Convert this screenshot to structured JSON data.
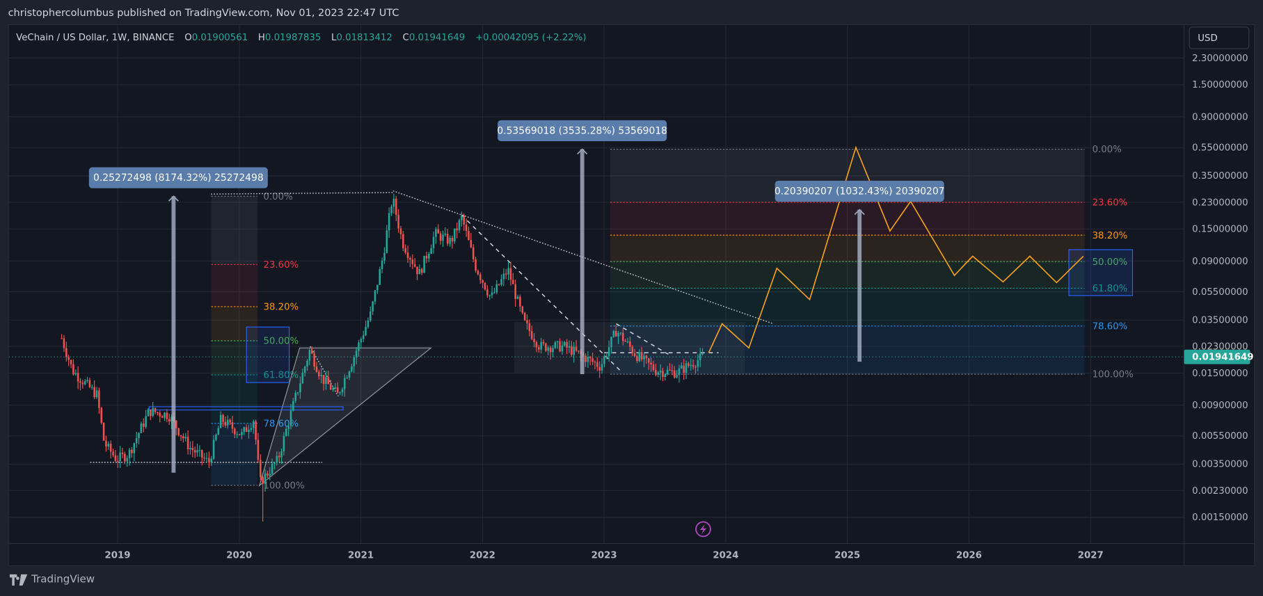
{
  "header": {
    "published": "christophercolumbus published on TradingView.com, Nov 01, 2023 22:47 UTC"
  },
  "legend": {
    "symbol": "VeChain / US Dollar, 1W, BINANCE",
    "o_label": "O",
    "o": "0.01900561",
    "h_label": "H",
    "h": "0.01987835",
    "l_label": "L",
    "l": "0.01813412",
    "c_label": "C",
    "c": "0.01941649",
    "change": "+0.00042095 (+2.22%)"
  },
  "price_axis": {
    "currency": "USD",
    "current_price": "0.01941649",
    "ticks": [
      {
        "value": 2.3,
        "label": "2.30000000"
      },
      {
        "value": 1.5,
        "label": "1.50000000"
      },
      {
        "value": 0.9,
        "label": "0.90000000"
      },
      {
        "value": 0.55,
        "label": "0.55000000"
      },
      {
        "value": 0.35,
        "label": "0.35000000"
      },
      {
        "value": 0.23,
        "label": "0.23000000"
      },
      {
        "value": 0.15,
        "label": "0.15000000"
      },
      {
        "value": 0.09,
        "label": "0.09000000"
      },
      {
        "value": 0.055,
        "label": "0.05500000"
      },
      {
        "value": 0.035,
        "label": "0.03500000"
      },
      {
        "value": 0.023,
        "label": "0.02300000"
      },
      {
        "value": 0.015,
        "label": "0.01500000"
      },
      {
        "value": 0.009,
        "label": "0.00900000"
      },
      {
        "value": 0.0055,
        "label": "0.00550000"
      },
      {
        "value": 0.0035,
        "label": "0.00350000"
      },
      {
        "value": 0.0023,
        "label": "0.00230000"
      },
      {
        "value": 0.0015,
        "label": "0.00150000"
      }
    ]
  },
  "time_axis": {
    "ticks": [
      "2019",
      "2020",
      "2021",
      "2022",
      "2023",
      "2024",
      "2025",
      "2026",
      "2027"
    ]
  },
  "footer": {
    "logo_text": "TradingView"
  },
  "colors": {
    "up": "#26a69a",
    "down": "#ef5350",
    "projection": "#f7a21b",
    "measure": "#5a7cab",
    "background": "#131722",
    "alert": "#ab47bc"
  },
  "chart_data": {
    "type": "candlestick",
    "title": "VeChain / US Dollar, 1W, BINANCE",
    "scale": "log",
    "ylim": [
      0.0013,
      2.6
    ],
    "xlim": [
      2018.45,
      2027.8
    ],
    "price_path": [
      [
        2018.54,
        0.0262
      ],
      [
        2018.63,
        0.0156
      ],
      [
        2018.83,
        0.0106
      ],
      [
        2018.89,
        0.0049
      ],
      [
        2018.99,
        0.0038
      ],
      [
        2019.09,
        0.0041
      ],
      [
        2019.26,
        0.0082
      ],
      [
        2019.42,
        0.0077
      ],
      [
        2019.59,
        0.0046
      ],
      [
        2019.75,
        0.0036
      ],
      [
        2019.85,
        0.0072
      ],
      [
        2020.02,
        0.0056
      ],
      [
        2020.12,
        0.0072
      ],
      [
        2020.17,
        0.0026
      ],
      [
        2020.32,
        0.0038
      ],
      [
        2020.45,
        0.0094
      ],
      [
        2020.58,
        0.0216
      ],
      [
        2020.68,
        0.0138
      ],
      [
        2020.81,
        0.0106
      ],
      [
        2020.95,
        0.0202
      ],
      [
        2021.08,
        0.0385
      ],
      [
        2021.18,
        0.0948
      ],
      [
        2021.26,
        0.249
      ],
      [
        2021.34,
        0.1225
      ],
      [
        2021.48,
        0.0732
      ],
      [
        2021.61,
        0.139
      ],
      [
        2021.74,
        0.1225
      ],
      [
        2021.83,
        0.18
      ],
      [
        2021.94,
        0.0834
      ],
      [
        2022.07,
        0.0498
      ],
      [
        2022.21,
        0.0782
      ],
      [
        2022.34,
        0.0339
      ],
      [
        2022.47,
        0.023
      ],
      [
        2022.67,
        0.023
      ],
      [
        2022.8,
        0.0202
      ],
      [
        2022.97,
        0.0167
      ],
      [
        2023.1,
        0.0298
      ],
      [
        2023.26,
        0.0202
      ],
      [
        2023.43,
        0.0156
      ],
      [
        2023.6,
        0.0152
      ],
      [
        2023.81,
        0.0194
      ]
    ],
    "projection": [
      [
        2023.86,
        0.0208
      ],
      [
        2023.97,
        0.033
      ],
      [
        2024.19,
        0.0224
      ],
      [
        2024.42,
        0.08
      ],
      [
        2024.69,
        0.0485
      ],
      [
        2025.07,
        0.552
      ],
      [
        2025.35,
        0.145
      ],
      [
        2025.52,
        0.233
      ],
      [
        2025.88,
        0.0714
      ],
      [
        2026.03,
        0.097
      ],
      [
        2026.28,
        0.0644
      ],
      [
        2026.5,
        0.097
      ],
      [
        2026.72,
        0.0636
      ],
      [
        2026.94,
        0.097
      ]
    ],
    "fib_levels": [
      {
        "level": 0,
        "label": "0.00%",
        "color": "#787b86"
      },
      {
        "level": 0.236,
        "label": "23.60%",
        "color": "#f23645"
      },
      {
        "level": 0.382,
        "label": "38.20%",
        "color": "#ff9800"
      },
      {
        "level": 0.5,
        "label": "50.00%",
        "color": "#4caf50"
      },
      {
        "level": 0.618,
        "label": "61.80%",
        "color": "#089981"
      },
      {
        "level": 0.786,
        "label": "78.60%",
        "color": "#2196f3"
      },
      {
        "level": 1,
        "label": "100.00%",
        "color": "#787b86"
      }
    ],
    "fib_left": {
      "t_start": 2019.77,
      "t_end": 2020.15,
      "top": 0.2527,
      "bottom": 0.0025
    },
    "fib_right": {
      "t_start": 2023.05,
      "t_end": 2026.95,
      "top": 0.5357,
      "bottom": 0.01474
    },
    "measures": [
      {
        "t": 2019.46,
        "from": 0.003055,
        "to": 0.25272498,
        "label": "0.25272498 (8174.32%) 25272498"
      },
      {
        "t": 2022.82,
        "from": 0.01474,
        "to": 0.53569018,
        "label": "0.53569018 (3535.28%) 53569018"
      },
      {
        "t": 2025.1,
        "from": 0.018,
        "to": 0.20390207,
        "label": "0.20390207 (1032.43%) 20390207"
      }
    ]
  }
}
